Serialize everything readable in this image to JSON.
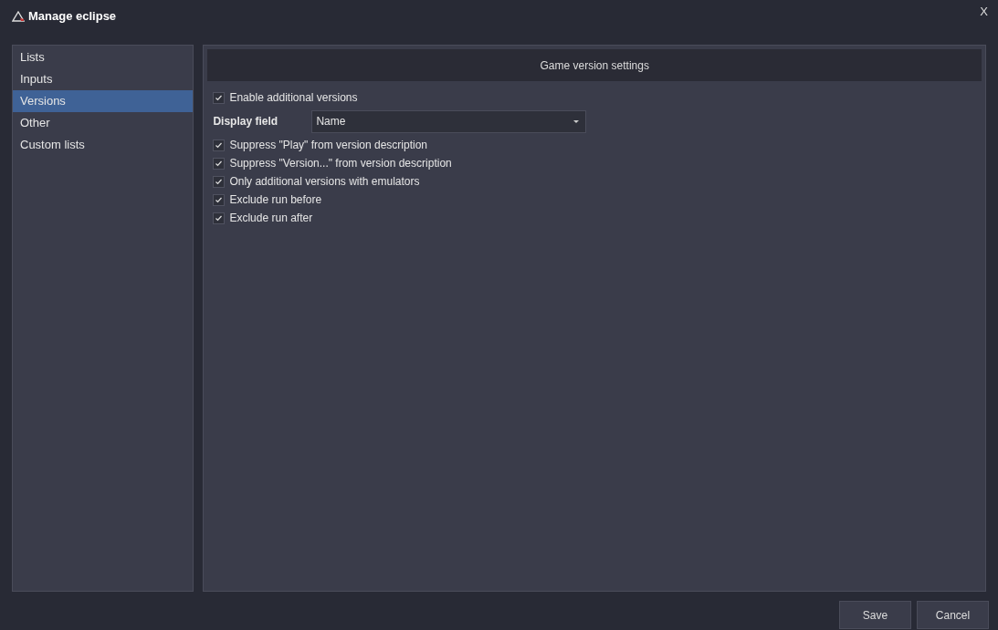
{
  "window": {
    "title": "Manage eclipse",
    "close": "X"
  },
  "sidebar": {
    "items": [
      {
        "label": "Lists",
        "selected": false
      },
      {
        "label": "Inputs",
        "selected": false
      },
      {
        "label": "Versions",
        "selected": true
      },
      {
        "label": "Other",
        "selected": false
      },
      {
        "label": "Custom lists",
        "selected": false
      }
    ]
  },
  "section_title": "Game version settings",
  "settings": [
    {
      "kind": "checkbox",
      "label": "Enable additional versions",
      "checked": true
    },
    {
      "kind": "dropdown",
      "label": "Display field",
      "value": "Name"
    },
    {
      "kind": "checkbox",
      "label": "Suppress \"Play\" from version description",
      "checked": true
    },
    {
      "kind": "checkbox",
      "label": "Suppress \"Version...\" from version description",
      "checked": true
    },
    {
      "kind": "checkbox",
      "label": "Only additional versions with emulators",
      "checked": true
    },
    {
      "kind": "checkbox",
      "label": "Exclude run before",
      "checked": true
    },
    {
      "kind": "checkbox",
      "label": "Exclude run after",
      "checked": true
    }
  ],
  "buttons": [
    "Save",
    "Cancel"
  ]
}
